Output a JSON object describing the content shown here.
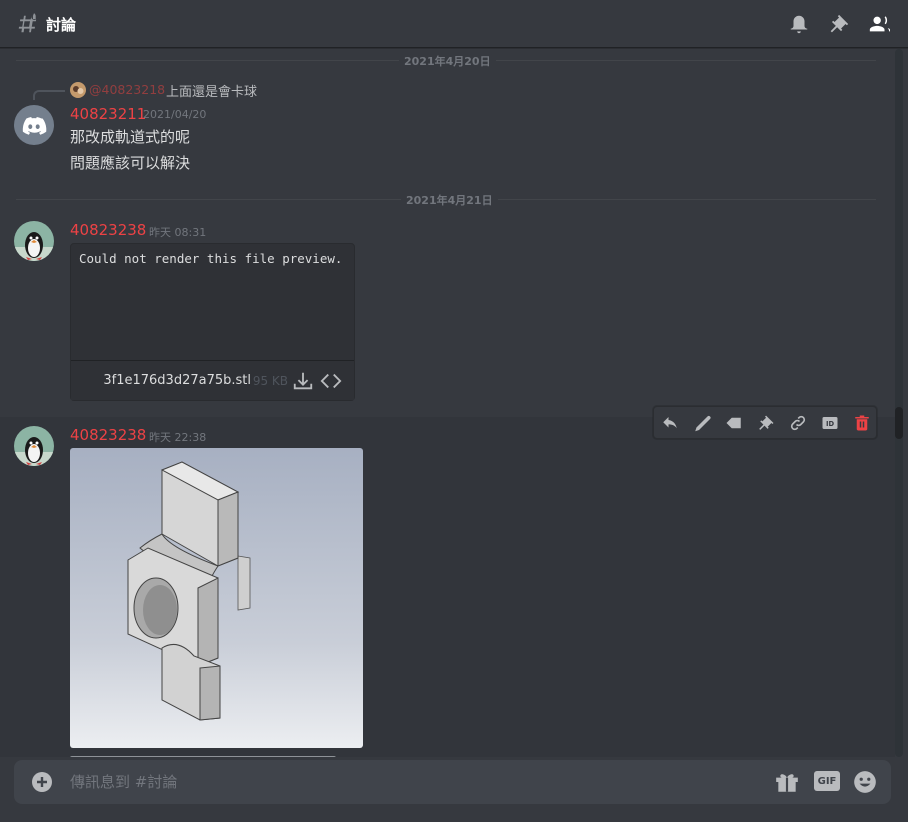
{
  "header": {
    "channel_name": "討論",
    "icons": [
      "hashtag-icon",
      "bell-icon",
      "pin-icon",
      "members-icon"
    ]
  },
  "dividers": [
    {
      "label": "2021年4月20日"
    },
    {
      "label": "2021年4月21日"
    }
  ],
  "messages": [
    {
      "reply": {
        "mention": "@40823218",
        "text": "上面還是會卡球"
      },
      "username": "40823211",
      "timestamp": "2021/04/20",
      "lines": [
        "那改成軌道式的呢",
        "問題應該可以解決"
      ],
      "avatar": "discord-default-avatar"
    },
    {
      "username": "40823238",
      "timestamp": "昨天 08:31",
      "attachment": {
        "preview_text": "Could not render this file preview.",
        "file_name": "3f1e176d3d27a75b.stl",
        "file_size": "95 KB"
      },
      "avatar": "penguin-avatar"
    },
    {
      "username": "40823238",
      "timestamp": "昨天 22:38",
      "attachment": {
        "type": "image",
        "description": "cad-render"
      },
      "avatar": "penguin-avatar"
    }
  ],
  "toolbar": {
    "buttons": [
      "reply-icon",
      "edit-icon",
      "tag-icon",
      "pin-icon",
      "link-icon",
      "id-icon",
      "delete-icon"
    ]
  },
  "input": {
    "placeholder": "傳訊息到 #討論",
    "icons": [
      "plus-icon",
      "gift-icon",
      "gif-icon",
      "emoji-icon"
    ],
    "gif_label": "GIF"
  },
  "colors": {
    "background": "#36393f",
    "username": "#ed4245",
    "accent": "#5865f2",
    "danger": "#ed4245"
  }
}
